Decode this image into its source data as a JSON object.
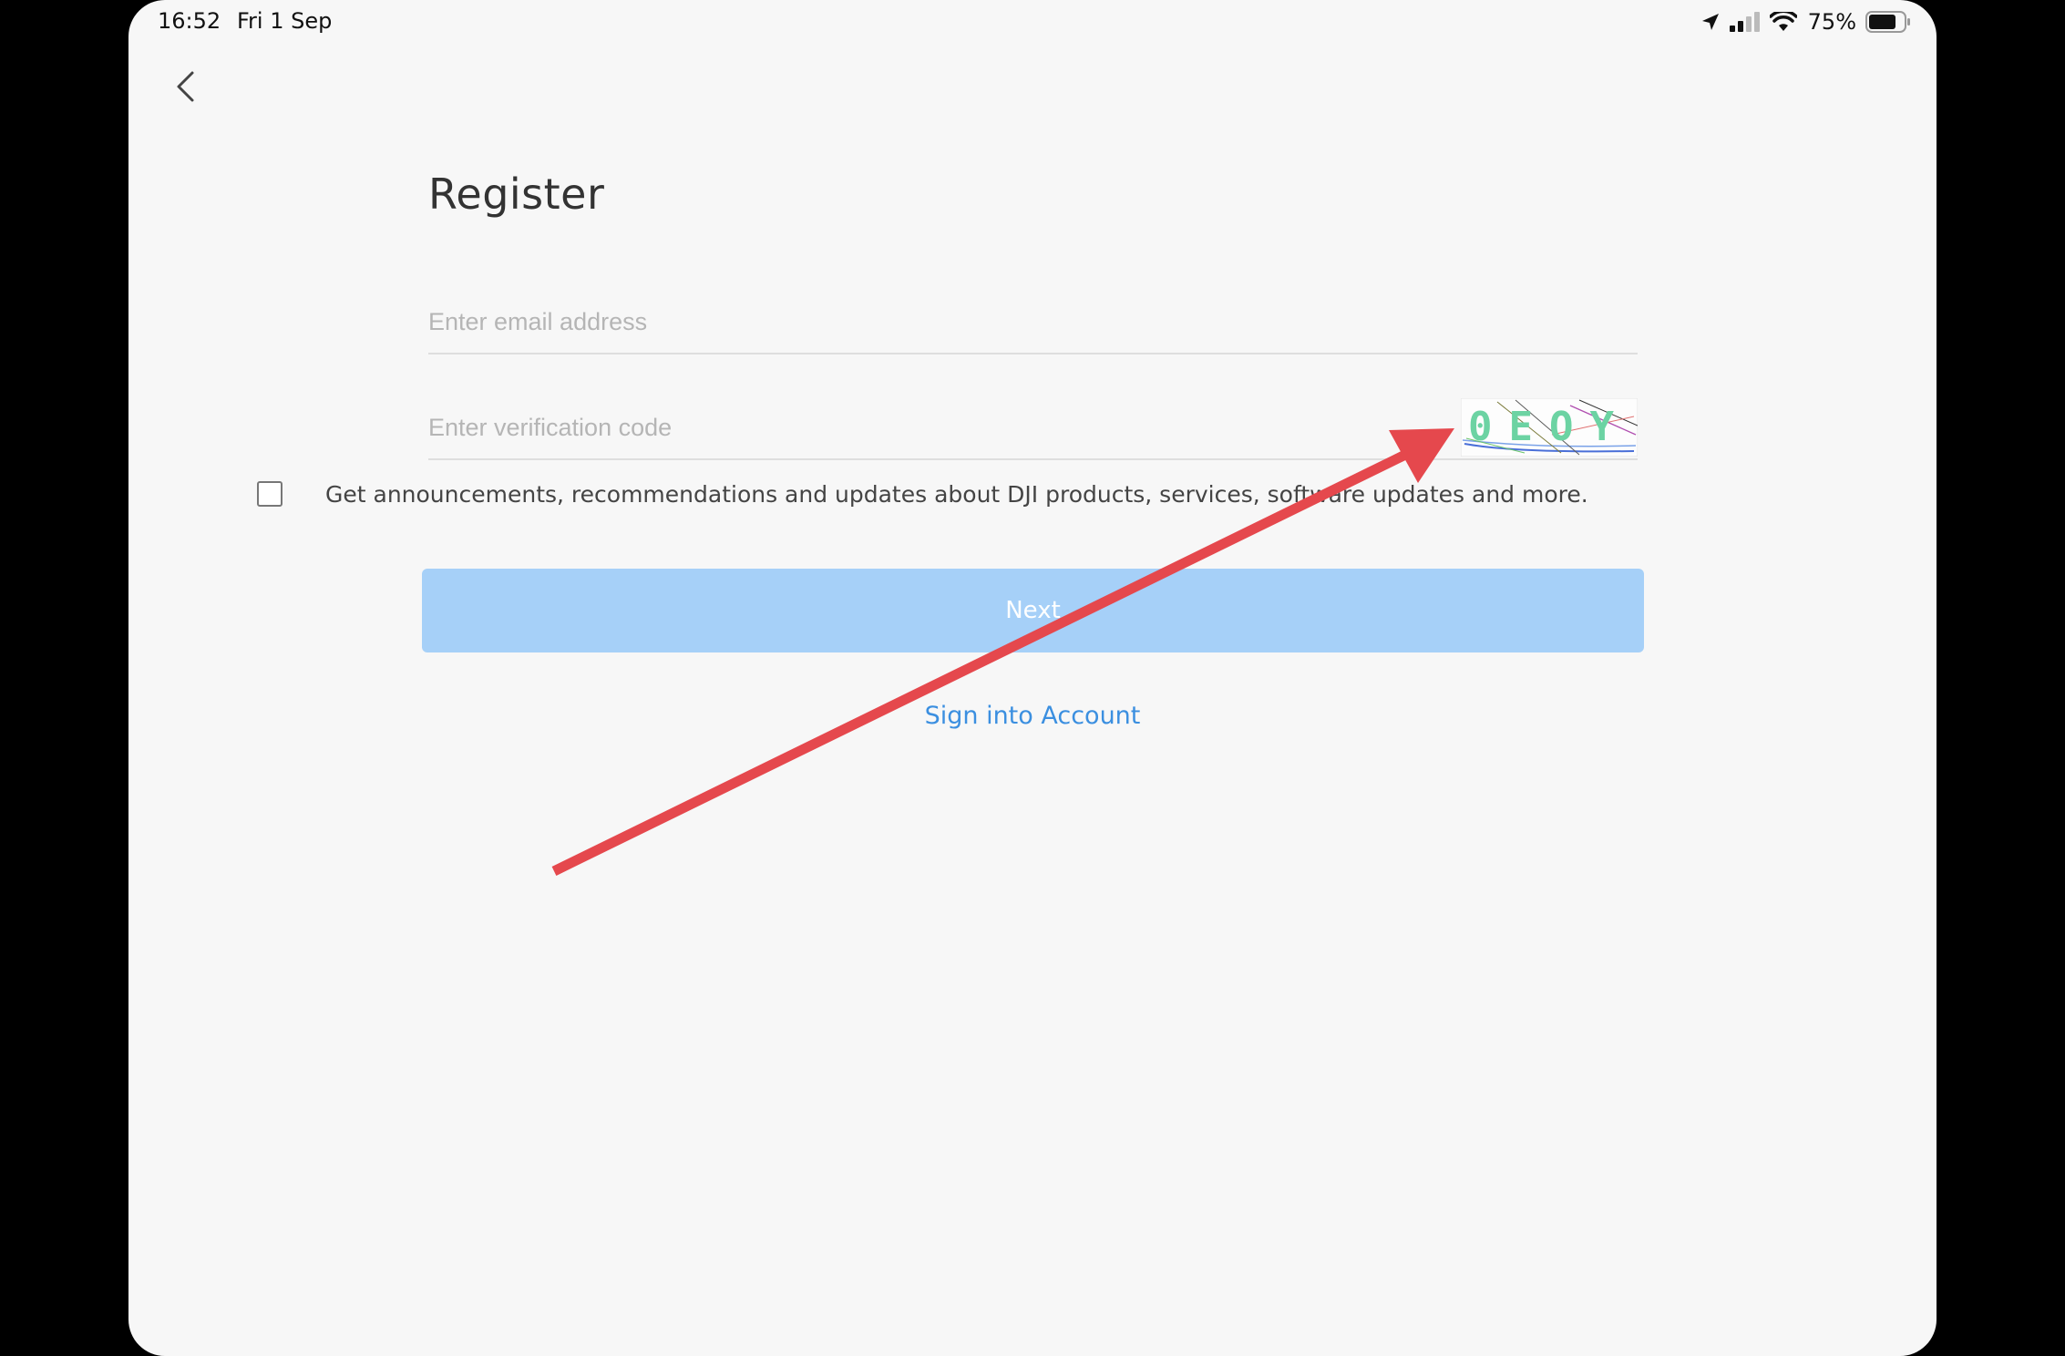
{
  "status_bar": {
    "time": "16:52",
    "date": "Fri 1 Sep",
    "battery": "75%",
    "icons": [
      "location-arrow-icon",
      "cellular-signal-icon",
      "wifi-icon",
      "battery-icon"
    ]
  },
  "nav": {
    "back_icon": "chevron-left-icon"
  },
  "form": {
    "title": "Register",
    "email_placeholder": "Enter email address",
    "email_value": "",
    "code_placeholder": "Enter verification code",
    "code_value": "",
    "captcha_text": "0EOY",
    "newsletter_label": "Get announcements, recommendations and updates about DJI products, services, software updates and more.",
    "newsletter_checked": false,
    "next_label": "Next",
    "signin_label": "Sign into Account"
  },
  "colors": {
    "background": "#f7f7f7",
    "button_disabled": "#a6d0f8",
    "link": "#3b8fe0",
    "annotation_arrow": "#e5484d"
  }
}
